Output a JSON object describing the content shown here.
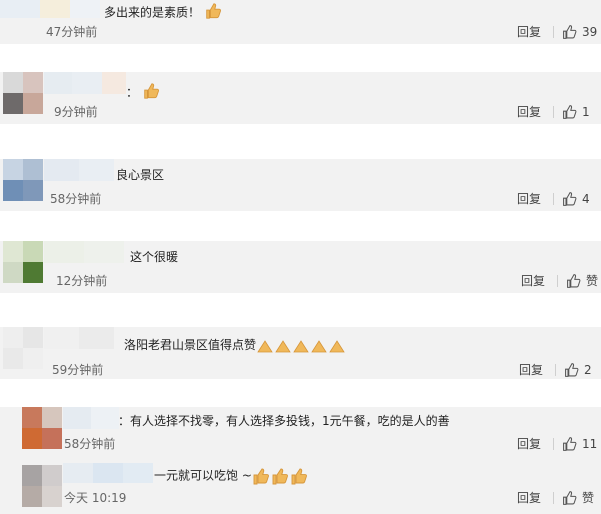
{
  "comments": [
    {
      "text": "多出来的是素质！",
      "emoji": [
        "thumbs-up"
      ],
      "time": "47分钟前",
      "reply": "回复",
      "likes": "39"
    },
    {
      "text": "：",
      "emoji": [
        "thumbs-up"
      ],
      "time": "9分钟前",
      "reply": "回复",
      "likes": "1"
    },
    {
      "text": "良心景区",
      "emoji": [],
      "time": "58分钟前",
      "reply": "回复",
      "likes": "4"
    },
    {
      "text": "这个很暖",
      "emoji": [],
      "time": "12分钟前",
      "reply": "回复",
      "likes": "赞"
    },
    {
      "text": "洛阳老君山景区值得点赞",
      "emoji": [
        "praying-hands",
        "praying-hands",
        "praying-hands",
        "praying-hands",
        "praying-hands"
      ],
      "time": "59分钟前",
      "reply": "回复",
      "likes": "2"
    },
    {
      "text": "：有人选择不找零，有人选择多投钱，1元午餐，吃的是人的善",
      "emoji": [],
      "time": "58分钟前",
      "reply": "回复",
      "likes": "11"
    },
    {
      "text": "一元就可以吃饱 ~",
      "emoji": [
        "thumbs-up",
        "thumbs-up",
        "thumbs-up"
      ],
      "time": "今天 10:19",
      "reply": "回复",
      "likes": "赞"
    }
  ],
  "icons": {
    "like": "thumbs-up-outline-icon",
    "emoji_thumb": "thumbs-up-emoji-icon",
    "emoji_pray": "praying-hands-emoji-icon"
  },
  "colors": {
    "card": "#f2f2f2",
    "emoji": "#f0b85a"
  }
}
